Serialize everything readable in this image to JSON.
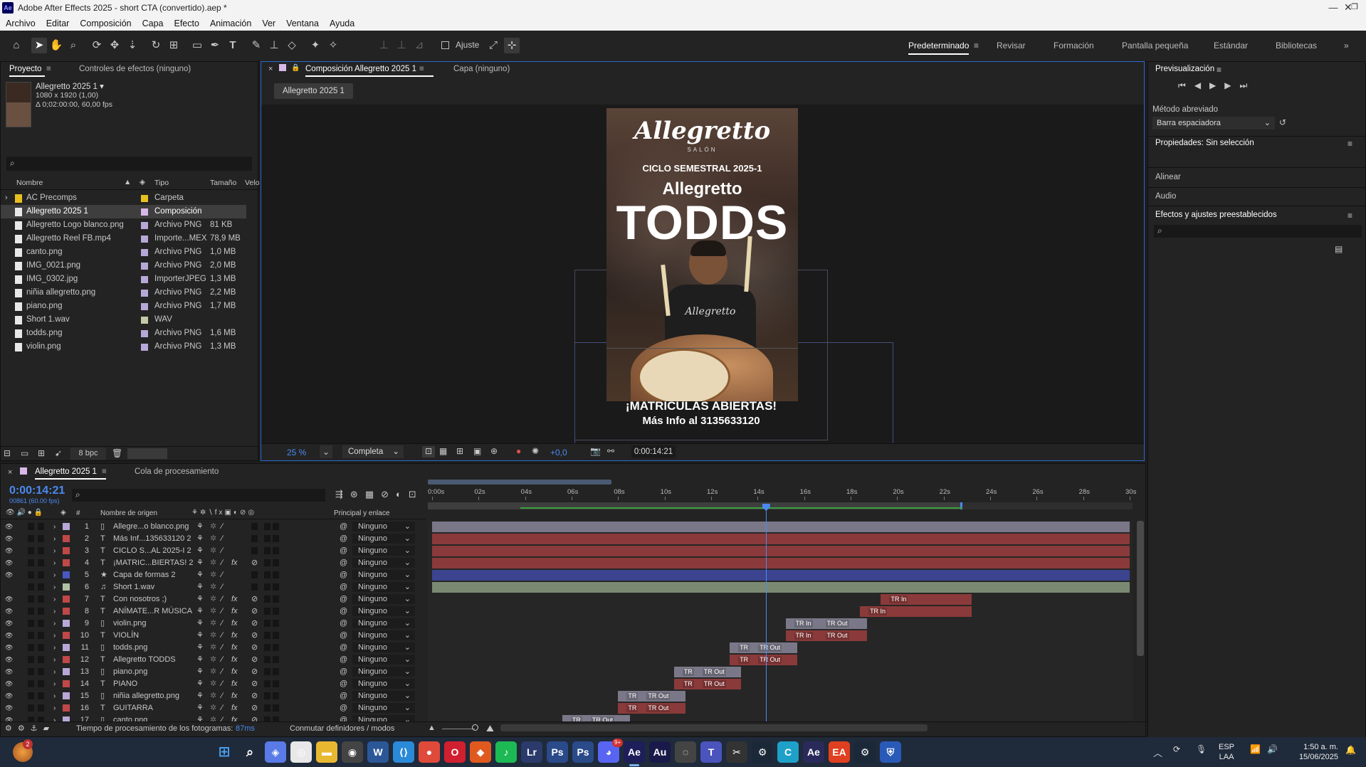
{
  "window": {
    "title": "Adobe After Effects 2025 - short CTA (convertido).aep *",
    "app_badge": "Ae"
  },
  "menu": [
    "Archivo",
    "Editar",
    "Composición",
    "Capa",
    "Efecto",
    "Animación",
    "Ver",
    "Ventana",
    "Ayuda"
  ],
  "toolbar": {
    "snap_label": "Ajuste"
  },
  "workspaces": [
    "Predeterminado",
    "Revisar",
    "Formación",
    "Pantalla pequeña",
    "Estándar",
    "Bibliotecas"
  ],
  "project_panel": {
    "tabs": [
      "Proyecto",
      "Controles de efectos (ninguno)"
    ],
    "selected_item": {
      "name": "Allegretto 2025 1",
      "size": "1080 x 1920 (1,00)",
      "duration": "Δ 0;02:00:00, 60,00 fps"
    },
    "columns": [
      "Nombre",
      "Tipo",
      "Tamaño",
      "Velo"
    ],
    "items": [
      {
        "name": "AC Precomps",
        "type": "Carpeta",
        "size": "",
        "color": "#e8c020",
        "icon": "folder-icon"
      },
      {
        "name": "Allegretto 2025 1",
        "type": "Composición",
        "size": "",
        "color": "#d8b8e8",
        "icon": "composition-icon"
      },
      {
        "name": "Allegretto Logo blanco.png",
        "type": "Archivo PNG",
        "size": "81 KB",
        "color": "#b8a8d8",
        "icon": "file-icon"
      },
      {
        "name": "Allegretto Reel FB.mp4",
        "type": "Importe...MEX",
        "size": "78,9 MB",
        "color": "#b8a8d8",
        "icon": "video-file-icon"
      },
      {
        "name": "canto.png",
        "type": "Archivo PNG",
        "size": "1,0 MB",
        "color": "#b8a8d8",
        "icon": "file-icon"
      },
      {
        "name": "IMG_0021.png",
        "type": "Archivo PNG",
        "size": "2,0 MB",
        "color": "#b8a8d8",
        "icon": "file-icon"
      },
      {
        "name": "IMG_0302.jpg",
        "type": "ImporterJPEG",
        "size": "1,3 MB",
        "color": "#b8a8d8",
        "icon": "file-icon"
      },
      {
        "name": "niñia allegretto.png",
        "type": "Archivo PNG",
        "size": "2,2 MB",
        "color": "#b8a8d8",
        "icon": "file-icon"
      },
      {
        "name": "piano.png",
        "type": "Archivo PNG",
        "size": "1,7 MB",
        "color": "#b8a8d8",
        "icon": "file-icon"
      },
      {
        "name": "Short 1.wav",
        "type": "WAV",
        "size": "",
        "color": "#c8c8a8",
        "icon": "audio-file-icon"
      },
      {
        "name": "todds.png",
        "type": "Archivo PNG",
        "size": "1,6 MB",
        "color": "#b8a8d8",
        "icon": "file-icon"
      },
      {
        "name": "violin.png",
        "type": "Archivo PNG",
        "size": "1,3 MB",
        "color": "#b8a8d8",
        "icon": "file-icon"
      }
    ],
    "bpc": "8 bpc"
  },
  "comp_viewer": {
    "tabs": [
      "Composición Allegretto 2025 1",
      "Capa (ninguno)"
    ],
    "breadcrumb": "Allegretto 2025 1",
    "poster": {
      "logo": "Allegretto",
      "logo_sub": "SALÓN",
      "line1": "CICLO SEMESTRAL 2025-1",
      "line2": "Allegretto",
      "line3": "TODDS",
      "cta1": "¡MATRICULAS ABIERTAS!",
      "cta2": "Más Info al 3135633120",
      "shirt_text": "Allegretto"
    },
    "zoom": "25 %",
    "resolution": "Completa",
    "exposure": "+0,0",
    "timecode": "0:00:14:21"
  },
  "right_panel": {
    "preview_title": "Previsualización",
    "shortcut_label": "Método abreviado",
    "shortcut_value": "Barra espaciadora",
    "properties_title": "Propiedades: Sin selección",
    "sections": [
      "Alinear",
      "Audio",
      "Efectos y ajustes preestablecidos"
    ]
  },
  "timeline": {
    "tabs": [
      "Allegretto 2025 1",
      "Cola de procesamiento"
    ],
    "timecode": "0:00:14:21",
    "frames": "00861 (60.00 fps)",
    "col_name": "Nombre de origen",
    "col_parent": "Principal y enlace",
    "ruler": [
      "0:00s",
      "02s",
      "04s",
      "06s",
      "08s",
      "10s",
      "12s",
      "14s",
      "16s",
      "18s",
      "20s",
      "22s",
      "24s",
      "26s",
      "28s",
      "30s"
    ],
    "layers": [
      {
        "num": "1",
        "name": "Allegre...o blanco.png",
        "color": "#b8a8d8",
        "type": "file",
        "parent": "Ninguno",
        "fx": false
      },
      {
        "num": "2",
        "name": "Más Inf...135633120 2",
        "color": "#c04848",
        "type": "text",
        "parent": "Ninguno",
        "fx": false
      },
      {
        "num": "3",
        "name": "CICLO S...AL 2025-I 2",
        "color": "#c04848",
        "type": "text",
        "parent": "Ninguno",
        "fx": false
      },
      {
        "num": "4",
        "name": "¡MATRIC...BIERTAS! 2",
        "color": "#c04848",
        "type": "text",
        "parent": "Ninguno",
        "fx": true
      },
      {
        "num": "5",
        "name": "Capa de formas 2",
        "color": "#4858c0",
        "type": "shape",
        "parent": "Ninguno",
        "fx": false
      },
      {
        "num": "6",
        "name": "Short 1.wav",
        "color": "#b0c0a0",
        "type": "audio",
        "parent": "Ninguno",
        "fx": false
      },
      {
        "num": "7",
        "name": "Con nosotros ;)",
        "color": "#c04848",
        "type": "text",
        "parent": "Ninguno",
        "fx": true
      },
      {
        "num": "8",
        "name": "ANÍMATE...R MÚSICA",
        "color": "#c04848",
        "type": "text",
        "parent": "Ninguno",
        "fx": true
      },
      {
        "num": "9",
        "name": "violin.png",
        "color": "#b8a8d8",
        "type": "file",
        "parent": "Ninguno",
        "fx": true
      },
      {
        "num": "10",
        "name": "VIOLÍN",
        "color": "#c04848",
        "type": "text",
        "parent": "Ninguno",
        "fx": true
      },
      {
        "num": "11",
        "name": "todds.png",
        "color": "#b8a8d8",
        "type": "file",
        "parent": "Ninguno",
        "fx": true
      },
      {
        "num": "12",
        "name": "Allegretto TODDS",
        "color": "#c04848",
        "type": "text",
        "parent": "Ninguno",
        "fx": true
      },
      {
        "num": "13",
        "name": "piano.png",
        "color": "#b8a8d8",
        "type": "file",
        "parent": "Ninguno",
        "fx": true
      },
      {
        "num": "14",
        "name": "PIANO",
        "color": "#c04848",
        "type": "text",
        "parent": "Ninguno",
        "fx": true
      },
      {
        "num": "15",
        "name": "niñia allegretto.png",
        "color": "#b8a8d8",
        "type": "file",
        "parent": "Ninguno",
        "fx": true
      },
      {
        "num": "16",
        "name": "GUITARRA",
        "color": "#c04848",
        "type": "text",
        "parent": "Ninguno",
        "fx": true
      },
      {
        "num": "17",
        "name": "canto.png",
        "color": "#b8a8d8",
        "type": "file",
        "parent": "Ninguno",
        "fx": true
      }
    ],
    "bars": [
      {
        "start": 0,
        "end": 30,
        "color": "#7a7888",
        "tags": []
      },
      {
        "start": 0,
        "end": 30,
        "color": "#8a3a3a",
        "tags": []
      },
      {
        "start": 0,
        "end": 30,
        "color": "#8a3a3a",
        "tags": []
      },
      {
        "start": 0,
        "end": 30,
        "color": "#8a3a3a",
        "tags": []
      },
      {
        "start": 0,
        "end": 30,
        "color": "#3c4490",
        "tags": []
      },
      {
        "start": 0,
        "end": 30,
        "color": "#7a8a72",
        "tags": []
      },
      {
        "start": 19.3,
        "end": 23.2,
        "color": "#8a3a3a",
        "tags": [
          "TR In"
        ]
      },
      {
        "start": 18.4,
        "end": 23.2,
        "color": "#8a3a3a",
        "tags": [
          "TR In"
        ]
      },
      {
        "start": 15.2,
        "end": 18.7,
        "color": "#7a7888",
        "tags": [
          "TR In",
          "TR Out"
        ]
      },
      {
        "start": 15.2,
        "end": 18.7,
        "color": "#8a3a3a",
        "tags": [
          "TR In",
          "TR Out"
        ]
      },
      {
        "start": 12.8,
        "end": 15.7,
        "color": "#7a7888",
        "tags": [
          "TR",
          "TR Out"
        ]
      },
      {
        "start": 12.8,
        "end": 15.7,
        "color": "#8a3a3a",
        "tags": [
          "TR",
          "TR Out"
        ]
      },
      {
        "start": 10.4,
        "end": 13.3,
        "color": "#7a7888",
        "tags": [
          "TR",
          "TR Out"
        ]
      },
      {
        "start": 10.4,
        "end": 13.3,
        "color": "#8a3a3a",
        "tags": [
          "TR",
          "TR Out"
        ]
      },
      {
        "start": 8.0,
        "end": 10.9,
        "color": "#7a7888",
        "tags": [
          "TR",
          "TR Out"
        ]
      },
      {
        "start": 8.0,
        "end": 10.9,
        "color": "#8a3a3a",
        "tags": [
          "TR",
          "TR Out"
        ]
      },
      {
        "start": 5.6,
        "end": 8.5,
        "color": "#7a7888",
        "tags": [
          "TR",
          "TR Out"
        ]
      }
    ],
    "playhead": 14.35,
    "work_area_end": 22.8,
    "render_time_label": "Tiempo de procesamiento de los fotogramas:",
    "render_time_value": "87ms",
    "switches_label": "Conmutar definidores / modos"
  },
  "taskbar": {
    "apps": [
      "Windows",
      "Buscar",
      "Copilot",
      "Chrome",
      "Explorador",
      "OBS",
      "Word",
      "VS Code",
      "Chrome",
      "Opera",
      "Brave",
      "Spotify",
      "Lr",
      "Ps",
      "Ps",
      "Discord",
      "Ae",
      "Au",
      "OBS",
      "Teams",
      "CapCut",
      "Steam",
      "Canva",
      "Ae",
      "EA",
      "Steam",
      "Defender"
    ],
    "lang1": "ESP",
    "lang2": "LAA",
    "time": "1:50 a. m.",
    "date": "15/06/2025",
    "notif": "2",
    "discord_badge": "9+"
  }
}
